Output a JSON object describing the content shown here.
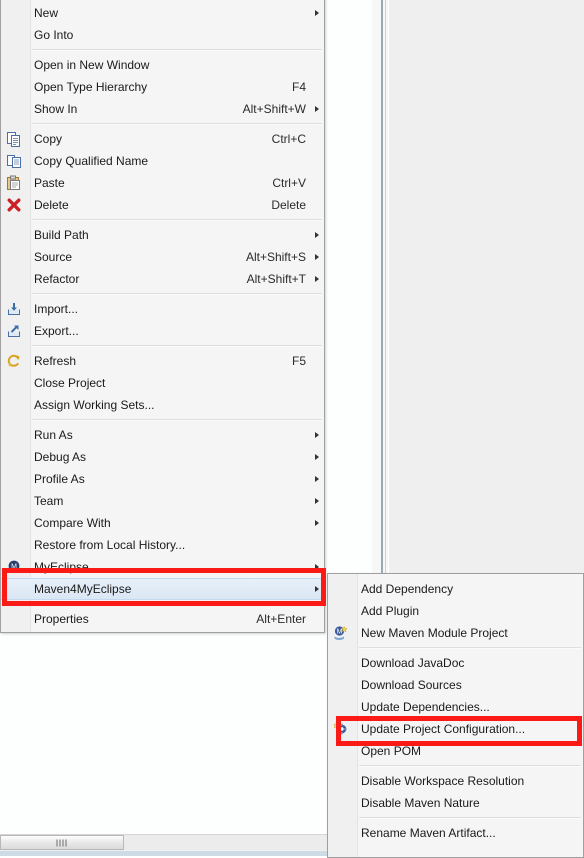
{
  "app": {
    "name": "Eclipse / MyEclipse IDE",
    "background_note": "Project Explorer context menu opened over editor area"
  },
  "colors": {
    "menu_background": "#f5f5f5",
    "menu_gutter": "#f0f0f0",
    "menu_border": "#a0a0a0",
    "selection_top": "#e8f0f9",
    "selection_bottom": "#dae7f4",
    "selection_border": "#c3d7ee",
    "annotation_red": "#fb1a15",
    "text": "#1a1a1a",
    "editor_right_pane": "#efefef",
    "sash": "#9aa9b2"
  },
  "context_menu": {
    "name": "project-context-menu",
    "groups": [
      {
        "items": [
          {
            "label": "New",
            "accel": "",
            "submenu": true,
            "icon": ""
          },
          {
            "label": "Go Into",
            "accel": "",
            "submenu": false,
            "icon": ""
          }
        ]
      },
      {
        "items": [
          {
            "label": "Open in New Window",
            "accel": "",
            "submenu": false,
            "icon": ""
          },
          {
            "label": "Open Type Hierarchy",
            "accel": "F4",
            "submenu": false,
            "icon": ""
          },
          {
            "label": "Show In",
            "accel": "Alt+Shift+W",
            "submenu": true,
            "icon": ""
          }
        ]
      },
      {
        "items": [
          {
            "label": "Copy",
            "accel": "Ctrl+C",
            "submenu": false,
            "icon": "copy-icon"
          },
          {
            "label": "Copy Qualified Name",
            "accel": "",
            "submenu": false,
            "icon": "copy-qualified-name-icon"
          },
          {
            "label": "Paste",
            "accel": "Ctrl+V",
            "submenu": false,
            "icon": "paste-icon"
          },
          {
            "label": "Delete",
            "accel": "Delete",
            "submenu": false,
            "icon": "delete-icon"
          }
        ]
      },
      {
        "items": [
          {
            "label": "Build Path",
            "accel": "",
            "submenu": true,
            "icon": ""
          },
          {
            "label": "Source",
            "accel": "Alt+Shift+S",
            "submenu": true,
            "icon": ""
          },
          {
            "label": "Refactor",
            "accel": "Alt+Shift+T",
            "submenu": true,
            "icon": ""
          }
        ]
      },
      {
        "items": [
          {
            "label": "Import...",
            "accel": "",
            "submenu": false,
            "icon": "import-icon"
          },
          {
            "label": "Export...",
            "accel": "",
            "submenu": false,
            "icon": "export-icon"
          }
        ]
      },
      {
        "items": [
          {
            "label": "Refresh",
            "accel": "F5",
            "submenu": false,
            "icon": "refresh-icon"
          },
          {
            "label": "Close Project",
            "accel": "",
            "submenu": false,
            "icon": ""
          },
          {
            "label": "Assign Working Sets...",
            "accel": "",
            "submenu": false,
            "icon": ""
          }
        ]
      },
      {
        "items": [
          {
            "label": "Run As",
            "accel": "",
            "submenu": true,
            "icon": ""
          },
          {
            "label": "Debug As",
            "accel": "",
            "submenu": true,
            "icon": ""
          },
          {
            "label": "Profile As",
            "accel": "",
            "submenu": true,
            "icon": ""
          },
          {
            "label": "Team",
            "accel": "",
            "submenu": true,
            "icon": ""
          },
          {
            "label": "Compare With",
            "accel": "",
            "submenu": true,
            "icon": ""
          },
          {
            "label": "Restore from Local History...",
            "accel": "",
            "submenu": false,
            "icon": ""
          },
          {
            "label": "MyEclipse",
            "accel": "",
            "submenu": true,
            "icon": "myeclipse-icon"
          },
          {
            "label": "Maven4MyEclipse",
            "accel": "",
            "submenu": true,
            "icon": "",
            "selected": true
          }
        ]
      },
      {
        "items": [
          {
            "label": "Properties",
            "accel": "Alt+Enter",
            "submenu": false,
            "icon": ""
          }
        ]
      }
    ]
  },
  "submenu": {
    "name": "maven4myeclipse-submenu",
    "groups": [
      {
        "items": [
          {
            "label": "Add Dependency",
            "icon": ""
          },
          {
            "label": "Add Plugin",
            "icon": ""
          },
          {
            "label": "New Maven Module Project",
            "icon": "new-maven-module-icon"
          }
        ]
      },
      {
        "items": [
          {
            "label": "Download JavaDoc",
            "icon": ""
          },
          {
            "label": "Download Sources",
            "icon": ""
          },
          {
            "label": "Update Dependencies...",
            "icon": ""
          },
          {
            "label": "Update Project Configuration...",
            "icon": "update-project-config-icon",
            "highlighted": true
          },
          {
            "label": "Open POM",
            "icon": ""
          }
        ]
      },
      {
        "items": [
          {
            "label": "Disable Workspace Resolution",
            "icon": ""
          },
          {
            "label": "Disable Maven Nature",
            "icon": ""
          }
        ]
      },
      {
        "items": [
          {
            "label": "Rename Maven Artifact...",
            "icon": ""
          }
        ]
      }
    ]
  },
  "annotations": [
    {
      "name": "annotation-maven4myeclipse",
      "target": "Maven4MyEclipse"
    },
    {
      "name": "annotation-update-project-configuration",
      "target": "Update Project Configuration..."
    }
  ]
}
